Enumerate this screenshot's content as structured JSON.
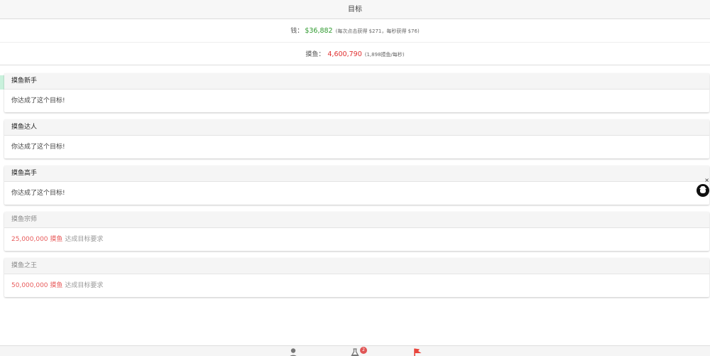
{
  "header": {
    "title": "目标"
  },
  "stats": {
    "money_label": "钱：",
    "money_value": "$36,882",
    "money_hint": "(每次点击获得 $271，每秒获得 $76)",
    "fish_label": "摸鱼：",
    "fish_value": "4,600,790",
    "fish_hint": "(1,898摸鱼/每秒)"
  },
  "goals": [
    {
      "title": "摸鱼新手",
      "status": "你达成了这个目标!"
    },
    {
      "title": "摸鱼达人",
      "status": "你达成了这个目标!"
    },
    {
      "title": "摸鱼高手",
      "status": "你达成了这个目标!"
    },
    {
      "title": "摸鱼宗师",
      "req_amount": "25,000,000",
      "req_unit": "摸鱼",
      "req_text": "达成目标要求"
    },
    {
      "title": "摸鱼之王",
      "req_amount": "50,000,000",
      "req_unit": "摸鱼",
      "req_text": "达成目标要求"
    }
  ],
  "side_widget": {
    "close": "×",
    "icon": "github-cat-icon"
  },
  "bottom_nav": {
    "items": [
      {
        "icon": "person-icon"
      },
      {
        "icon": "flask-icon",
        "badge": "2"
      },
      {
        "icon": "flag-icon"
      }
    ]
  },
  "colors": {
    "money": "#2e9a2e",
    "fish": "#e03030",
    "requirement": "#e85c5c",
    "flag": "#e8453c"
  }
}
